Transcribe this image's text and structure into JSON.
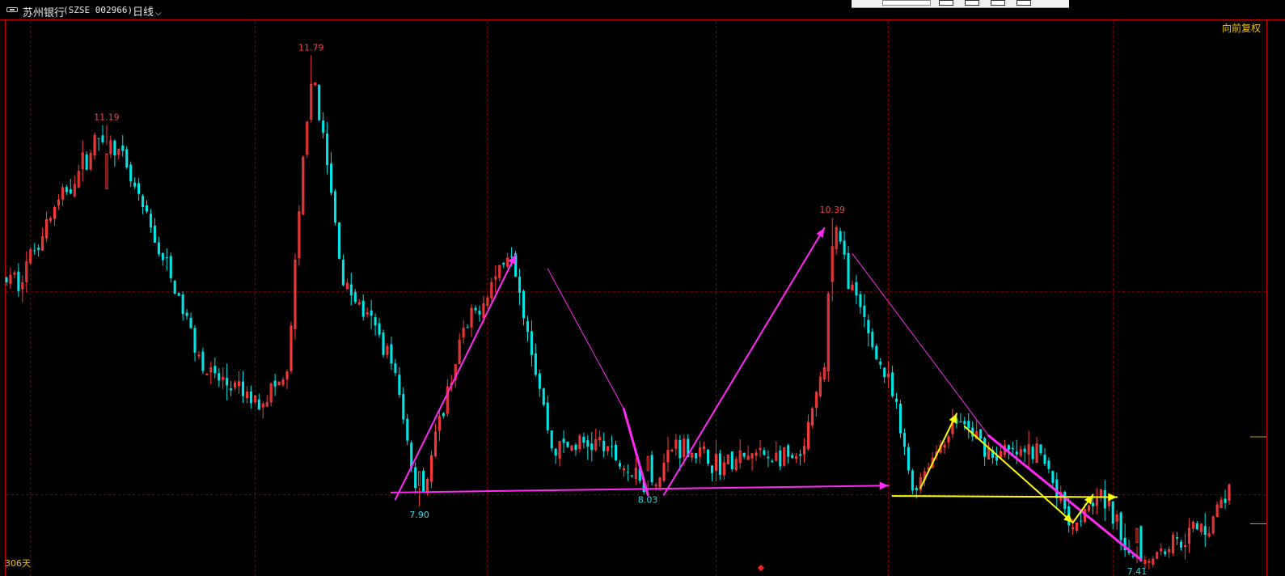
{
  "header": {
    "stock_name": "苏州银行",
    "stock_code": "(SZSE 002966)",
    "period": "日线"
  },
  "right_label": "向前复权",
  "bottom_left_label": "306天",
  "colors": {
    "background": "#000000",
    "up": "#ff3c3c",
    "down": "#00e5e5",
    "grid": "#8b0000",
    "magenta": "#ff2bf5",
    "yellow": "#ffff00",
    "text_yellow": "#f2c200"
  },
  "chart_data": {
    "type": "candlestick",
    "title": "",
    "xlabel": "",
    "ylabel": "",
    "ylim": [
      7.3,
      12.1
    ],
    "days": 306,
    "annotations": [
      {
        "text": "11.79",
        "price": 11.79,
        "kind": "high"
      },
      {
        "text": "11.19",
        "price": 11.19,
        "kind": "high"
      },
      {
        "text": "10.39",
        "price": 10.39,
        "kind": "high"
      },
      {
        "text": "7.90",
        "price": 7.9,
        "kind": "low"
      },
      {
        "text": "8.03",
        "price": 8.03,
        "kind": "low"
      },
      {
        "text": "7.41",
        "price": 7.41,
        "kind": "low"
      }
    ],
    "key_points": [
      {
        "day": 3,
        "price": 9.85
      },
      {
        "day": 10,
        "price": 10.35
      },
      {
        "day": 25,
        "price": 11.19
      },
      {
        "day": 40,
        "price": 9.95
      },
      {
        "day": 50,
        "price": 9.05
      },
      {
        "day": 62,
        "price": 8.8
      },
      {
        "day": 70,
        "price": 9.0
      },
      {
        "day": 76,
        "price": 11.79
      },
      {
        "day": 84,
        "price": 9.85
      },
      {
        "day": 96,
        "price": 9.2
      },
      {
        "day": 103,
        "price": 7.9
      },
      {
        "day": 113,
        "price": 9.3
      },
      {
        "day": 126,
        "price": 10.15
      },
      {
        "day": 136,
        "price": 8.4
      },
      {
        "day": 148,
        "price": 8.45
      },
      {
        "day": 160,
        "price": 8.03
      },
      {
        "day": 167,
        "price": 8.45
      },
      {
        "day": 178,
        "price": 8.25
      },
      {
        "day": 188,
        "price": 8.35
      },
      {
        "day": 198,
        "price": 8.28
      },
      {
        "day": 204,
        "price": 9.1
      },
      {
        "day": 206,
        "price": 10.39
      },
      {
        "day": 212,
        "price": 9.65
      },
      {
        "day": 221,
        "price": 8.85
      },
      {
        "day": 226,
        "price": 8.05
      },
      {
        "day": 237,
        "price": 8.65
      },
      {
        "day": 246,
        "price": 8.35
      },
      {
        "day": 258,
        "price": 8.35
      },
      {
        "day": 266,
        "price": 7.75
      },
      {
        "day": 272,
        "price": 8.05
      },
      {
        "day": 282,
        "price": 7.41
      },
      {
        "day": 294,
        "price": 7.65
      },
      {
        "day": 300,
        "price": 7.75
      },
      {
        "day": 305,
        "price": 8.05
      }
    ],
    "trend_lines": [
      {
        "color": "magenta",
        "width": 2,
        "arrow": true,
        "from": [
          97,
          7.96
        ],
        "to": [
          127,
          10.07
        ]
      },
      {
        "color": "magenta",
        "width": 1,
        "arrow": false,
        "from": [
          135,
          9.95
        ],
        "to": [
          154,
          8.74
        ]
      },
      {
        "color": "magenta",
        "width": 3,
        "arrow": false,
        "from": [
          154,
          8.74
        ],
        "to": [
          160,
          8.0
        ]
      },
      {
        "color": "magenta",
        "width": 2,
        "arrow": true,
        "from": [
          96,
          8.02
        ],
        "to": [
          220,
          8.08
        ]
      },
      {
        "color": "magenta",
        "width": 2,
        "arrow": true,
        "from": [
          164,
          8.0
        ],
        "to": [
          204,
          10.3
        ]
      },
      {
        "color": "magenta",
        "width": 1,
        "arrow": false,
        "from": [
          211,
          10.08
        ],
        "to": [
          245,
          8.51
        ]
      },
      {
        "color": "magenta",
        "width": 3,
        "arrow": false,
        "from": [
          245,
          8.51
        ],
        "to": [
          283,
          7.44
        ]
      },
      {
        "color": "yellow",
        "width": 2,
        "arrow": true,
        "from": [
          221,
          7.99
        ],
        "to": [
          277,
          7.98
        ]
      },
      {
        "color": "yellow",
        "width": 2,
        "arrow": true,
        "from": [
          228,
          8.06
        ],
        "to": [
          237,
          8.7
        ]
      },
      {
        "color": "yellow",
        "width": 2,
        "arrow": true,
        "from": [
          239,
          8.59
        ],
        "to": [
          266,
          7.76
        ]
      },
      {
        "color": "yellow",
        "width": 2,
        "arrow": true,
        "from": [
          266,
          7.76
        ],
        "to": [
          271,
          8.0
        ]
      }
    ],
    "grid": {
      "horizontal_dashed_prices": [
        9.75,
        8.0
      ],
      "vertical_dashed_days": [
        6,
        62,
        120,
        177,
        220,
        276
      ]
    }
  }
}
